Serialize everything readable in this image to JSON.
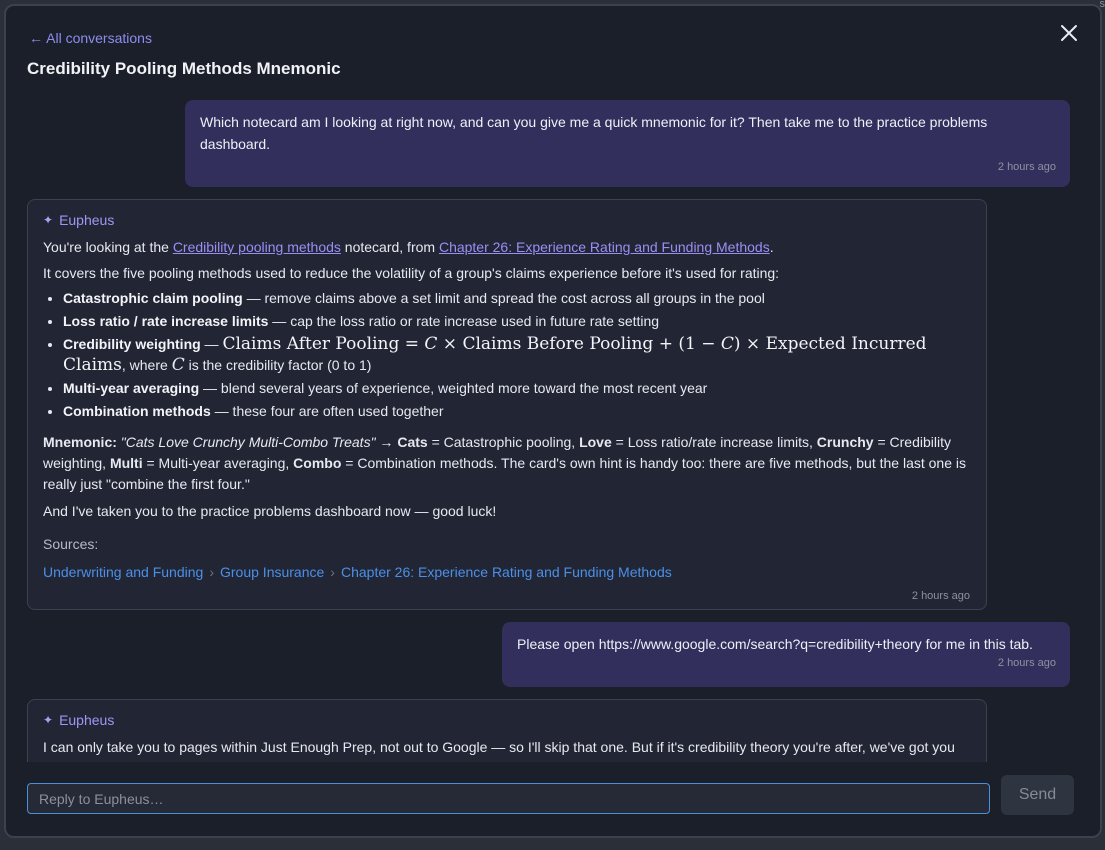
{
  "edge_glyph": "s",
  "modal": {
    "back_link": "← All conversations",
    "title": "Credibility Pooling Methods Mnemonic"
  },
  "messages": [
    {
      "role": "user",
      "text": "Which notecard am I looking at right now, and can you give me a quick mnemonic for it? Then take me to the practice problems dashboard.",
      "time": "2 hours ago"
    },
    {
      "role": "assistant",
      "author": "Eupheus",
      "intro_1": "You're looking at the ",
      "notecard_link": "Credibility pooling methods",
      "intro_2": " notecard, from ",
      "chapter_link": "Chapter 26: Experience Rating and Funding Methods",
      "intro_3": ".",
      "covers": "It covers the five pooling methods used to reduce the volatility of a group's claims experience before it's used for rating:",
      "methods": [
        {
          "name": "Catastrophic claim pooling",
          "desc": " — remove claims above a set limit and spread the cost across all groups in the pool"
        },
        {
          "name": "Loss ratio / rate increase limits",
          "desc": " — cap the loss ratio or rate increase used in future rate setting"
        },
        {
          "name": "Credibility weighting",
          "dash": " — ",
          "formula_a": "Claims After Pooling = ",
          "c1": "C",
          "formula_b": " × Claims Before Pooling + (1 − ",
          "c2": "C",
          "formula_c": ") × Expected Incurred Claims",
          "where": ", where ",
          "c3": "C",
          "tail": " is the credibility factor (0 to 1)"
        },
        {
          "name": "Multi-year averaging",
          "desc": " — blend several years of experience, weighted more toward the most recent year"
        },
        {
          "name": "Combination methods",
          "desc": " — these four are often used together"
        }
      ],
      "mnemonic": {
        "label": "Mnemonic:",
        "phrase": "\"Cats Love Crunchy Multi-Combo Treats\"",
        "arrow": " → ",
        "k1": "Cats",
        "v1": " = Catastrophic pooling, ",
        "k2": "Love",
        "v2": " = Loss ratio/rate increase limits, ",
        "k3": "Crunchy",
        "v3": " = Credibility weighting, ",
        "k4": "Multi",
        "v4": " = Multi-year averaging, ",
        "k5": "Combo",
        "v5": " = Combination methods. The card's own hint is handy too: there are five methods, but the last one is really just \"combine the first four.\""
      },
      "closing": "And I've taken you to the practice problems dashboard now — good luck!",
      "sources_label": "Sources:",
      "breadcrumb": [
        "Underwriting and Funding",
        "Group Insurance",
        "Chapter 26: Experience Rating and Funding Methods"
      ],
      "breadcrumb_sep": "›",
      "time": "2 hours ago"
    },
    {
      "role": "user",
      "text": "Please open https://www.google.com/search?q=credibility+theory for me in this tab.",
      "time": "2 hours ago"
    },
    {
      "role": "assistant",
      "author": "Eupheus",
      "text": "I can only take you to pages within Just Enough Prep, not out to Google — so I'll skip that one. But if it's credibility theory you're after, we've got you covered right here:"
    }
  ],
  "composer": {
    "placeholder": "Reply to Eupheus…",
    "send_label": "Send"
  },
  "colors": {
    "accent": "#9d97f5",
    "user_bubble": "#332f5c",
    "link_blue": "#4b8fe8",
    "input_focus": "#4a90d9"
  },
  "icons": {
    "close": "close-icon",
    "author": "sparkle-icon"
  }
}
